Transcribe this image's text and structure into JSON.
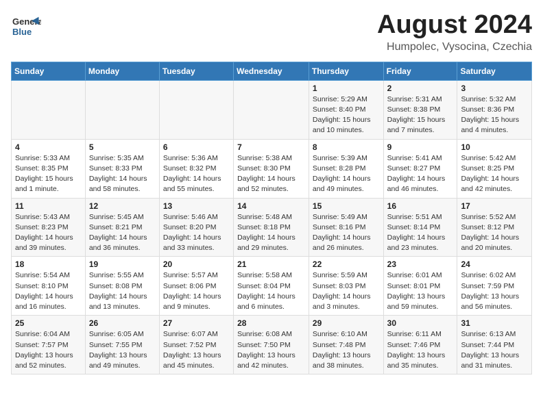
{
  "header": {
    "logo_general": "General",
    "logo_blue": "Blue",
    "main_title": "August 2024",
    "subtitle": "Humpolec, Vysocina, Czechia"
  },
  "calendar": {
    "days_of_week": [
      "Sunday",
      "Monday",
      "Tuesday",
      "Wednesday",
      "Thursday",
      "Friday",
      "Saturday"
    ],
    "weeks": [
      {
        "cells": [
          {
            "day": null,
            "info": null
          },
          {
            "day": null,
            "info": null
          },
          {
            "day": null,
            "info": null
          },
          {
            "day": null,
            "info": null
          },
          {
            "day": "1",
            "info": "Sunrise: 5:29 AM\nSunset: 8:40 PM\nDaylight: 15 hours\nand 10 minutes."
          },
          {
            "day": "2",
            "info": "Sunrise: 5:31 AM\nSunset: 8:38 PM\nDaylight: 15 hours\nand 7 minutes."
          },
          {
            "day": "3",
            "info": "Sunrise: 5:32 AM\nSunset: 8:36 PM\nDaylight: 15 hours\nand 4 minutes."
          }
        ]
      },
      {
        "cells": [
          {
            "day": "4",
            "info": "Sunrise: 5:33 AM\nSunset: 8:35 PM\nDaylight: 15 hours\nand 1 minute."
          },
          {
            "day": "5",
            "info": "Sunrise: 5:35 AM\nSunset: 8:33 PM\nDaylight: 14 hours\nand 58 minutes."
          },
          {
            "day": "6",
            "info": "Sunrise: 5:36 AM\nSunset: 8:32 PM\nDaylight: 14 hours\nand 55 minutes."
          },
          {
            "day": "7",
            "info": "Sunrise: 5:38 AM\nSunset: 8:30 PM\nDaylight: 14 hours\nand 52 minutes."
          },
          {
            "day": "8",
            "info": "Sunrise: 5:39 AM\nSunset: 8:28 PM\nDaylight: 14 hours\nand 49 minutes."
          },
          {
            "day": "9",
            "info": "Sunrise: 5:41 AM\nSunset: 8:27 PM\nDaylight: 14 hours\nand 46 minutes."
          },
          {
            "day": "10",
            "info": "Sunrise: 5:42 AM\nSunset: 8:25 PM\nDaylight: 14 hours\nand 42 minutes."
          }
        ]
      },
      {
        "cells": [
          {
            "day": "11",
            "info": "Sunrise: 5:43 AM\nSunset: 8:23 PM\nDaylight: 14 hours\nand 39 minutes."
          },
          {
            "day": "12",
            "info": "Sunrise: 5:45 AM\nSunset: 8:21 PM\nDaylight: 14 hours\nand 36 minutes."
          },
          {
            "day": "13",
            "info": "Sunrise: 5:46 AM\nSunset: 8:20 PM\nDaylight: 14 hours\nand 33 minutes."
          },
          {
            "day": "14",
            "info": "Sunrise: 5:48 AM\nSunset: 8:18 PM\nDaylight: 14 hours\nand 29 minutes."
          },
          {
            "day": "15",
            "info": "Sunrise: 5:49 AM\nSunset: 8:16 PM\nDaylight: 14 hours\nand 26 minutes."
          },
          {
            "day": "16",
            "info": "Sunrise: 5:51 AM\nSunset: 8:14 PM\nDaylight: 14 hours\nand 23 minutes."
          },
          {
            "day": "17",
            "info": "Sunrise: 5:52 AM\nSunset: 8:12 PM\nDaylight: 14 hours\nand 20 minutes."
          }
        ]
      },
      {
        "cells": [
          {
            "day": "18",
            "info": "Sunrise: 5:54 AM\nSunset: 8:10 PM\nDaylight: 14 hours\nand 16 minutes."
          },
          {
            "day": "19",
            "info": "Sunrise: 5:55 AM\nSunset: 8:08 PM\nDaylight: 14 hours\nand 13 minutes."
          },
          {
            "day": "20",
            "info": "Sunrise: 5:57 AM\nSunset: 8:06 PM\nDaylight: 14 hours\nand 9 minutes."
          },
          {
            "day": "21",
            "info": "Sunrise: 5:58 AM\nSunset: 8:04 PM\nDaylight: 14 hours\nand 6 minutes."
          },
          {
            "day": "22",
            "info": "Sunrise: 5:59 AM\nSunset: 8:03 PM\nDaylight: 14 hours\nand 3 minutes."
          },
          {
            "day": "23",
            "info": "Sunrise: 6:01 AM\nSunset: 8:01 PM\nDaylight: 13 hours\nand 59 minutes."
          },
          {
            "day": "24",
            "info": "Sunrise: 6:02 AM\nSunset: 7:59 PM\nDaylight: 13 hours\nand 56 minutes."
          }
        ]
      },
      {
        "cells": [
          {
            "day": "25",
            "info": "Sunrise: 6:04 AM\nSunset: 7:57 PM\nDaylight: 13 hours\nand 52 minutes."
          },
          {
            "day": "26",
            "info": "Sunrise: 6:05 AM\nSunset: 7:55 PM\nDaylight: 13 hours\nand 49 minutes."
          },
          {
            "day": "27",
            "info": "Sunrise: 6:07 AM\nSunset: 7:52 PM\nDaylight: 13 hours\nand 45 minutes."
          },
          {
            "day": "28",
            "info": "Sunrise: 6:08 AM\nSunset: 7:50 PM\nDaylight: 13 hours\nand 42 minutes."
          },
          {
            "day": "29",
            "info": "Sunrise: 6:10 AM\nSunset: 7:48 PM\nDaylight: 13 hours\nand 38 minutes."
          },
          {
            "day": "30",
            "info": "Sunrise: 6:11 AM\nSunset: 7:46 PM\nDaylight: 13 hours\nand 35 minutes."
          },
          {
            "day": "31",
            "info": "Sunrise: 6:13 AM\nSunset: 7:44 PM\nDaylight: 13 hours\nand 31 minutes."
          }
        ]
      }
    ]
  }
}
